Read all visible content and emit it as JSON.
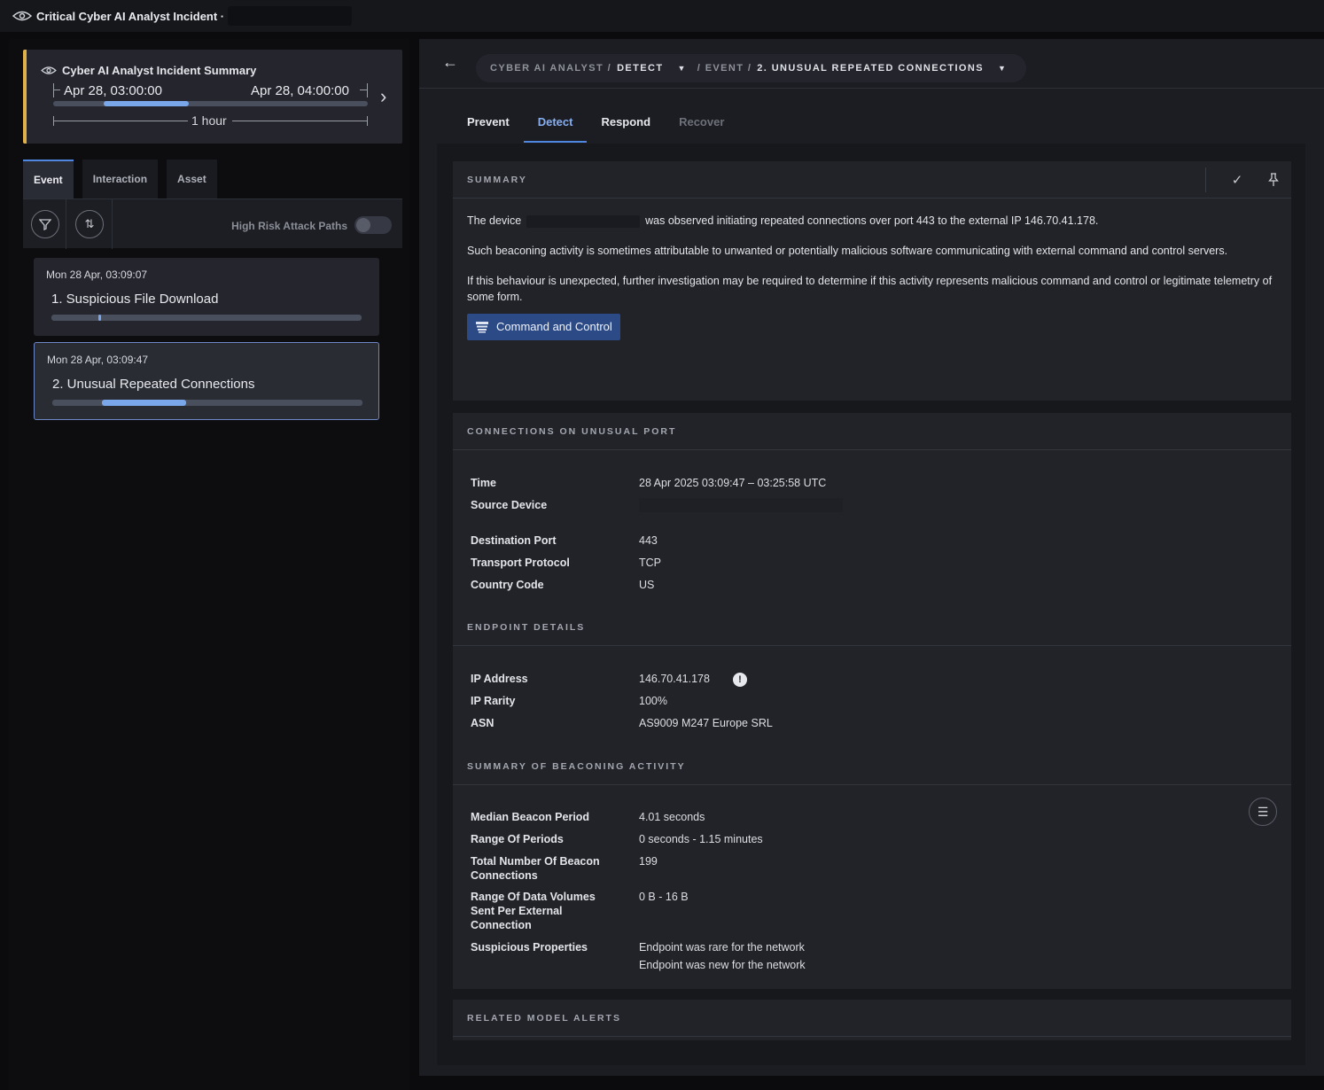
{
  "topbar": {
    "title": "Critical Cyber AI Analyst Incident ·"
  },
  "summary_card": {
    "title": "Cyber AI Analyst Incident Summary",
    "start": "Apr 28, 03:00:00",
    "end": "Apr 28, 04:00:00",
    "scale_label": "1 hour",
    "highlighted_window_fraction": [
      0.16,
      0.43
    ]
  },
  "left_tabs": [
    {
      "label": "Event",
      "active": true
    },
    {
      "label": "Interaction",
      "active": false
    },
    {
      "label": "Asset",
      "active": false
    }
  ],
  "filters": {
    "high_risk_label": "High Risk Attack Paths",
    "high_risk_enabled": false
  },
  "events": [
    {
      "date": "Mon 28 Apr, 03:09:07",
      "name": "1. Suspicious File Download",
      "selected": false,
      "progress": [
        0.15,
        0.16
      ]
    },
    {
      "date": "Mon 28 Apr, 03:09:47",
      "name": "2. Unusual Repeated Connections",
      "selected": true,
      "progress": [
        0.16,
        0.43
      ]
    }
  ],
  "breadcrumb": {
    "parts": [
      "CYBER AI ANALYST /",
      "DETECT",
      "/ EVENT /",
      "2. UNUSUAL REPEATED CONNECTIONS"
    ]
  },
  "right_tabs": [
    {
      "label": "Prevent",
      "state": "normal"
    },
    {
      "label": "Detect",
      "state": "active"
    },
    {
      "label": "Respond",
      "state": "normal"
    },
    {
      "label": "Recover",
      "state": "dim"
    }
  ],
  "summary": {
    "heading": "SUMMARY",
    "p1_prefix": "The device",
    "p1_suffix": "was observed initiating repeated connections over port 443 to the external IP 146.70.41.178.",
    "p2": "Such beaconing activity is sometimes attributable to unwanted or potentially malicious software communicating with external command and control servers.",
    "p3": "If this behaviour is unexpected, further investigation may be required to determine if this activity represents malicious command and control or legitimate telemetry of some form.",
    "tag": "Command and Control"
  },
  "connections": {
    "heading": "CONNECTIONS ON UNUSUAL PORT",
    "rows": [
      {
        "k": "Time",
        "v": "28 Apr 2025 03:09:47 – 03:25:58 UTC"
      },
      {
        "k": "Source Device",
        "v": ""
      },
      {
        "k": "Destination Port",
        "v": "443"
      },
      {
        "k": "Transport Protocol",
        "v": "TCP"
      },
      {
        "k": "Country Code",
        "v": "US"
      }
    ]
  },
  "endpoint": {
    "heading": "ENDPOINT DETAILS",
    "rows": [
      {
        "k": "IP Address",
        "v": "146.70.41.178"
      },
      {
        "k": "IP Rarity",
        "v": "100%"
      },
      {
        "k": "ASN",
        "v": "AS9009 M247 Europe SRL"
      }
    ]
  },
  "beaconing": {
    "heading": "SUMMARY OF BEACONING ACTIVITY",
    "rows": [
      {
        "k": "Median Beacon Period",
        "v": "4.01 seconds"
      },
      {
        "k": "Range Of Periods",
        "v": "0 seconds - 1.15 minutes"
      },
      {
        "k": "Total Number Of Beacon Connections",
        "v": "199"
      },
      {
        "k": "Range Of Data Volumes Sent Per External Connection",
        "v": "0 B - 16 B"
      },
      {
        "k": "Suspicious Properties",
        "v": "Endpoint was rare for the network",
        "v2": "Endpoint was new for the network"
      }
    ]
  },
  "related": {
    "heading": "RELATED MODEL ALERTS"
  },
  "colors": {
    "accent": "#4e86e0",
    "progress": "#7aa6ea",
    "critical": "#e0b14a",
    "tag_bg": "#2b4a86"
  }
}
